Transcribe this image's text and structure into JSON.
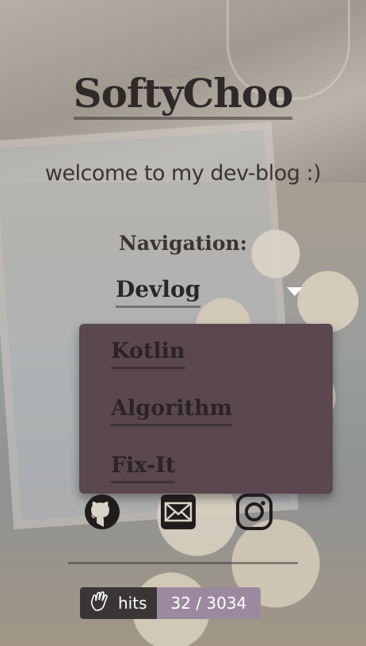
{
  "site": {
    "title": "SoftyChoo",
    "tagline": "welcome to my dev-blog :)"
  },
  "navigation": {
    "label": "Navigation:",
    "selected": "Devlog",
    "items": [
      {
        "label": "Kotlin"
      },
      {
        "label": "Algorithm"
      },
      {
        "label": "Fix-It"
      }
    ]
  },
  "social": {
    "icons": [
      "github-icon",
      "mail-icon",
      "instagram-icon"
    ]
  },
  "hits": {
    "label": "hits",
    "value": "32 / 3034"
  },
  "colors": {
    "menu_bg": "#5a474f",
    "hits_left_bg": "#3a3636",
    "hits_right_bg": "#9b8a9e"
  }
}
